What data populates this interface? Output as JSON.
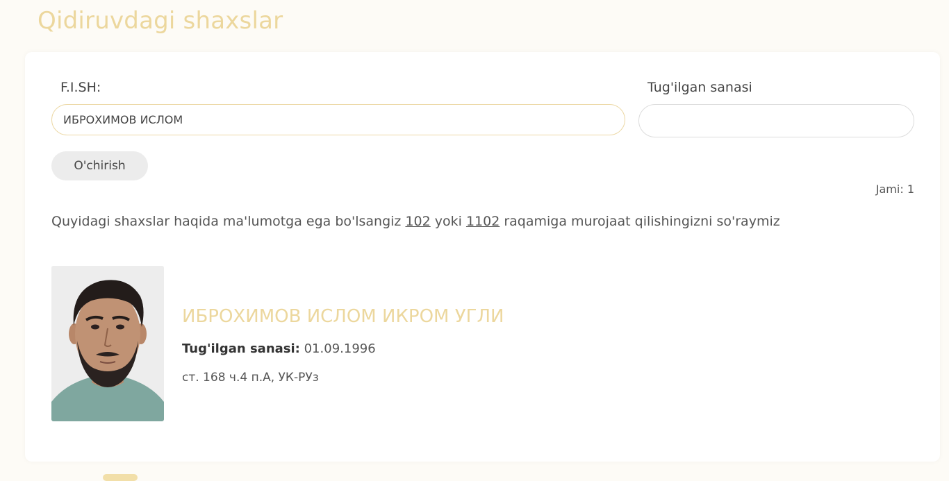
{
  "page": {
    "title": "Qidiruvdagi shaxslar"
  },
  "search": {
    "name_label": "F.I.SH:",
    "name_value": "ИБРОХИМОВ ИСЛОМ",
    "date_label": "Tug'ilgan sanasi",
    "date_value": "",
    "clear_label": "O'chirish"
  },
  "results": {
    "total_text": "Jami: 1",
    "notice_before": "Quyidagi shaxslar haqida ma'lumotga ega bo'lsangiz ",
    "phone_1": "102",
    "notice_middle": " yoki ",
    "phone_2": "1102",
    "notice_after": " raqamiga murojaat qilishingizni so'raymiz",
    "items": [
      {
        "name": "ИБРОХИМОВ ИСЛОМ ИКРОМ УГЛИ",
        "dob_label": "Tug'ilgan sanasi:",
        "dob_value": "01.09.1996",
        "article": "ст. 168 ч.4 п.А, УК-РУз"
      }
    ]
  },
  "colors": {
    "accent": "#ecd79d",
    "background": "#fdfbf6",
    "card": "#ffffff",
    "button": "#ececec"
  }
}
